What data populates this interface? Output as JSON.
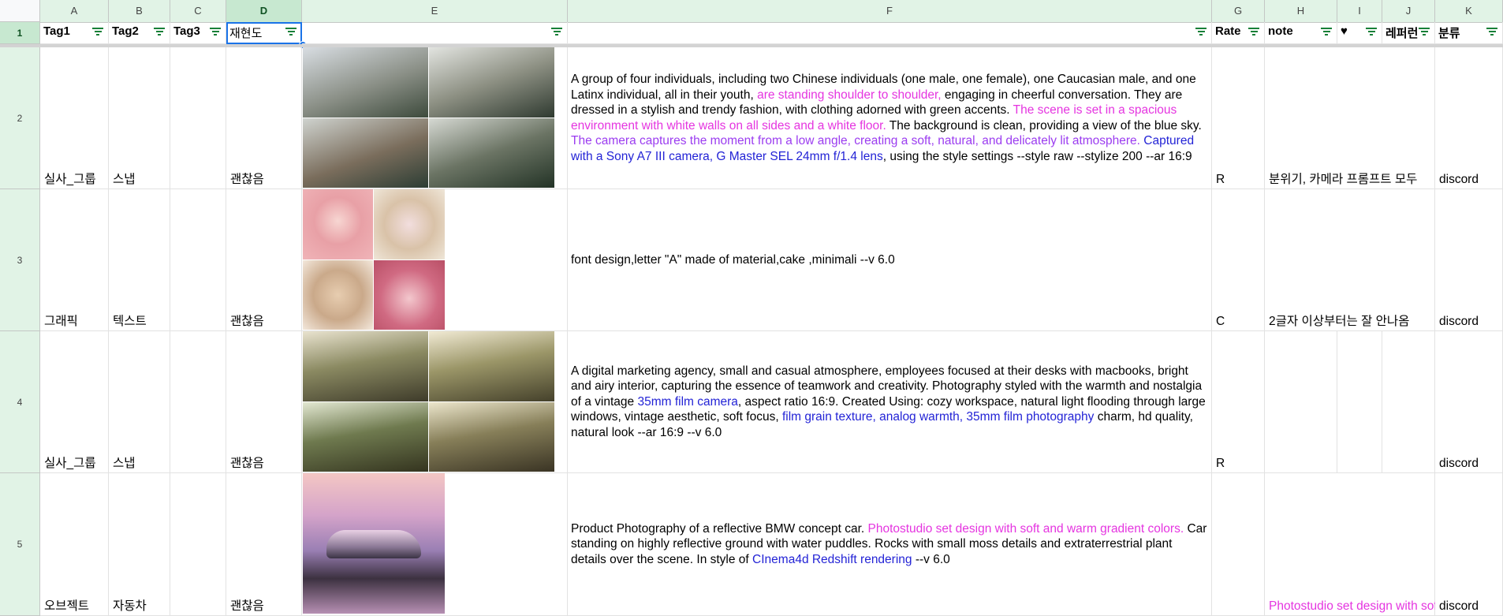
{
  "columns": [
    "A",
    "B",
    "C",
    "D",
    "E",
    "F",
    "G",
    "H",
    "I",
    "J",
    "K"
  ],
  "row_numbers": [
    "1",
    "2",
    "3",
    "4",
    "5"
  ],
  "headers": {
    "a": "Tag1",
    "b": "Tag2",
    "c": "Tag3",
    "d": "재현도",
    "e": "",
    "f": "",
    "g": "Rate",
    "h": "note",
    "i": "♥",
    "j": "레퍼런",
    "k": "분류"
  },
  "rows": [
    {
      "tag1": "실사_그룹",
      "tag2": "스냅",
      "tag3": "",
      "repro": "괜찮음",
      "prompt_segments": [
        {
          "t": "A group of four individuals, including two Chinese individuals (one male, one female), one Caucasian male, and one Latinx individual, all in their youth, ",
          "c": ""
        },
        {
          "t": "are standing shoulder to shoulder,",
          "c": "pk"
        },
        {
          "t": " engaging in cheerful conversation. They are dressed in a stylish and trendy fashion, with clothing adorned with green accents. ",
          "c": ""
        },
        {
          "t": "The scene is set in a spacious environment with white walls on all sides and a white floor.",
          "c": "pk"
        },
        {
          "t": " The background is clean, providing a view of the blue sky. ",
          "c": ""
        },
        {
          "t": "The camera captures the moment from a low angle, creating a soft, natural, and delicately lit atmosphere.",
          "c": "pv"
        },
        {
          "t": " ",
          "c": ""
        },
        {
          "t": "Captured with a Sony A7 III camera, G Master SEL 24mm f/1.4 lens",
          "c": "pb"
        },
        {
          "t": ", using the style settings --style raw --stylize 200 --ar 16:9",
          "c": ""
        }
      ],
      "rate": "R",
      "note": "분위기, 카메라 프롬프트 모두",
      "heart": "",
      "ref": "",
      "category": "discord"
    },
    {
      "tag1": "그래픽",
      "tag2": "텍스트",
      "tag3": "",
      "repro": "괜찮음",
      "prompt_segments": [
        {
          "t": "font design,letter \"A\" made of material,cake ,minimali --v 6.0",
          "c": ""
        }
      ],
      "rate": "C",
      "note": "2글자 이상부터는 잘 안나옴",
      "heart": "",
      "ref": "",
      "category": "discord"
    },
    {
      "tag1": "실사_그룹",
      "tag2": "스냅",
      "tag3": "",
      "repro": "괜찮음",
      "prompt_segments": [
        {
          "t": "A digital marketing agency, small and casual atmosphere, employees focused at their desks with macbooks, bright and airy interior, capturing the essence of teamwork and creativity. Photography styled with the warmth and nostalgia of a vintage ",
          "c": ""
        },
        {
          "t": "35mm film camera",
          "c": "pb"
        },
        {
          "t": ", aspect ratio 16:9. Created Using: cozy workspace, natural light flooding through large windows, vintage aesthetic, soft focus, ",
          "c": ""
        },
        {
          "t": "film grain texture, analog warmth, 35mm film photography",
          "c": "pb"
        },
        {
          "t": " charm, hd quality, natural look --ar 16:9 --v 6.0",
          "c": ""
        }
      ],
      "rate": "R",
      "note": "",
      "heart": "",
      "ref": "",
      "category": "discord"
    },
    {
      "tag1": "오브젝트",
      "tag2": "자동차",
      "tag3": "",
      "repro": "괜찮음",
      "prompt_segments": [
        {
          "t": "Product Photography of a reflective BMW concept car. ",
          "c": ""
        },
        {
          "t": "Photostudio set design with soft and warm gradient colors.",
          "c": "pk"
        },
        {
          "t": " Car standing on highly reflective ground with water puddles. Rocks with small moss details and extraterrestrial plant details over the scene. In style of ",
          "c": ""
        },
        {
          "t": "CInema4d Redshift rendering",
          "c": "pb"
        },
        {
          "t": " --v 6.0",
          "c": ""
        }
      ],
      "rate": "",
      "note": "Photostudio set design with soft",
      "heart": "",
      "ref": "",
      "category": "discord"
    }
  ],
  "colors": {
    "header_green": "#e1f3e6",
    "selected_header": "#c7e8d0",
    "filter_icon": "#188038",
    "selection": "#1a73e8",
    "highlight_pink": "#e535e0",
    "highlight_violet": "#9b3cf0",
    "highlight_blue": "#2323d6"
  }
}
